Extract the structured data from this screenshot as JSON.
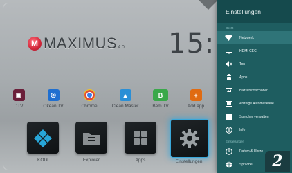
{
  "launcher": {
    "logo_mark": "M",
    "brand": "MAXIMUS",
    "version": "4.0",
    "clock": "15:2",
    "apps": [
      {
        "label": "DTV",
        "icon": "tv-icon",
        "color": "#6b1f3a",
        "glyph": "■"
      },
      {
        "label": "Okean TV",
        "icon": "okean-tv-icon",
        "color": "#1f6fd0",
        "glyph": "◎"
      },
      {
        "label": "Chrome",
        "icon": "chrome-icon",
        "color": "#d04a3a",
        "glyph": "●"
      },
      {
        "label": "Clean Master",
        "icon": "broom-icon",
        "color": "#2a8fd6",
        "glyph": "▲"
      },
      {
        "label": "Bem TV",
        "icon": "bem-tv-icon",
        "color": "#3aa84a",
        "glyph": "B"
      },
      {
        "label": "Add app",
        "icon": "add-app-icon",
        "color": "#e06b12",
        "glyph": "+"
      }
    ],
    "tiles": [
      {
        "label": "KODI",
        "icon": "kodi-icon"
      },
      {
        "label": "Explorer",
        "icon": "folder-icon"
      },
      {
        "label": "Apps",
        "icon": "apps-grid-icon"
      },
      {
        "label": "Einstellungen",
        "icon": "gear-icon"
      }
    ]
  },
  "settings_panel": {
    "title": "Einstellungen",
    "section_device": "Gerät",
    "section_settings": "Einstellungen",
    "items_device": [
      {
        "label": "Netzwerk",
        "icon": "wifi-icon"
      },
      {
        "label": "HDMI CEC",
        "icon": "hdmi-icon"
      },
      {
        "label": "Ton",
        "icon": "sound-off-icon"
      },
      {
        "label": "Apps",
        "icon": "android-icon"
      },
      {
        "label": "Bildschirmschoner",
        "icon": "screensaver-icon"
      },
      {
        "label": "Anzeige Automatikabe",
        "icon": "display-icon"
      },
      {
        "label": "Speicher verwalten",
        "icon": "storage-icon"
      },
      {
        "label": "Info",
        "icon": "info-icon"
      }
    ],
    "items_settings": [
      {
        "label": "Datum & Uhrze",
        "icon": "clock-icon"
      },
      {
        "label": "Sprache",
        "icon": "globe-icon"
      }
    ]
  },
  "badge_number": "2",
  "colors": {
    "panel_bg": "#1e5d60",
    "panel_header": "#154a4d",
    "active_item": "#2f7478",
    "selection_glow": "#3aa7d9"
  }
}
